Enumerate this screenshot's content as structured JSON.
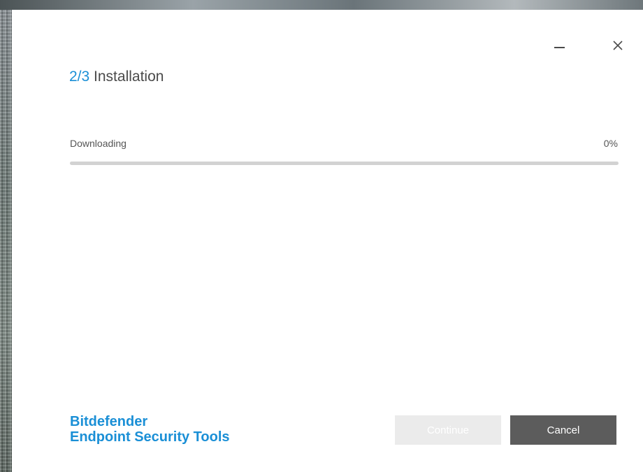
{
  "window": {
    "minimize_icon": "minimize-icon",
    "close_icon": "close-icon"
  },
  "header": {
    "step": "2/3",
    "title": "Installation"
  },
  "progress": {
    "label": "Downloading",
    "percent_text": "0%",
    "fraction": 0,
    "track_color": "#d2d2d2",
    "fill_color": "#1a8fd6"
  },
  "brand": {
    "name": "Bitdefender",
    "product": "Endpoint Security Tools",
    "color": "#1a8fd6"
  },
  "buttons": {
    "continue_label": "Continue",
    "continue_enabled": false,
    "cancel_label": "Cancel"
  }
}
